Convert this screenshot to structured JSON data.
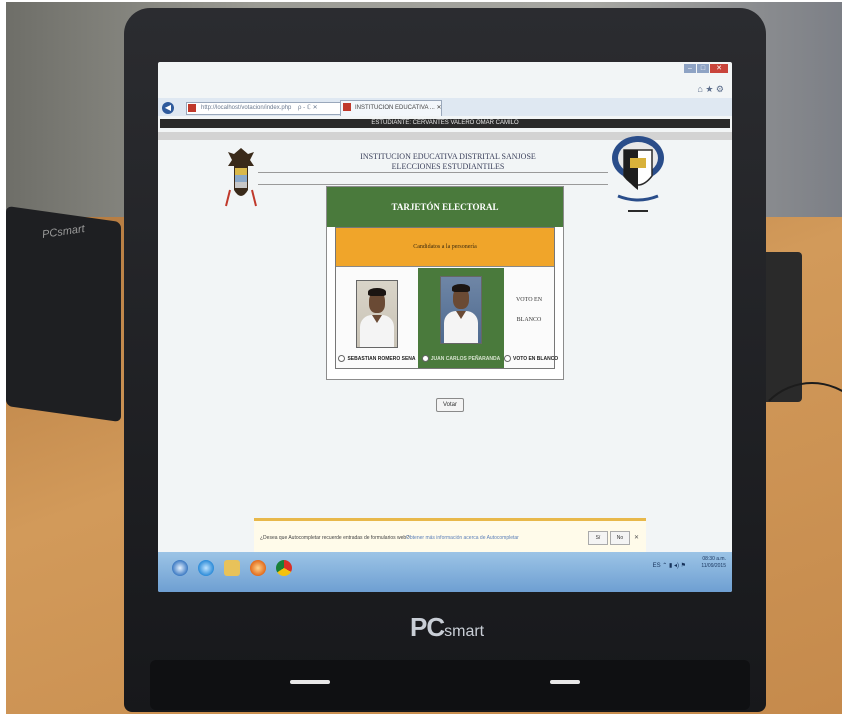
{
  "browser": {
    "address_text": "http://localhost/votacion/index.php",
    "address_controls": "ρ - ℂ ✕",
    "tab_title": "INSTITUCION EDUCATIVA ... ✕",
    "window_controls": {
      "minimize": "–",
      "maximize": "□",
      "close": "✕"
    },
    "toolbar_icons": "⌂ ★ ⚙"
  },
  "page": {
    "student_line": "ESTUDIANTE: CERVANTES VALERO OMAR CAMILO",
    "school_name": "INSTITUCION EDUCATIVA DISTRITAL SANJOSE",
    "election_title": "ELECCIONES ESTUDIANTILES"
  },
  "ballot": {
    "header": "TARJETÓN ELECTORAL",
    "position": "Candidatos a la personería",
    "candidates": [
      {
        "label": "SEBASTIAN ROMERO SENA"
      },
      {
        "label": "JUAN CARLOS PEÑARANDA"
      },
      {
        "label": "VOTO EN BLANCO"
      }
    ],
    "blank_text_line1": "VOTO EN",
    "blank_text_line2": "BLANCO",
    "vote_button": "Votar"
  },
  "autocomplete": {
    "message": "¿Desea que Autocompletar recuerde entradas de formularios web?",
    "link": "Obtener más información acerca de Autocompletar",
    "yes": "Sí",
    "no": "No",
    "close": "✕"
  },
  "taskbar": {
    "time": "08:30 a.m.",
    "date": "11/09/2015",
    "tray_icons": "ES ⌃ ▮ ◂) ⚑"
  },
  "device": {
    "brand": "PC",
    "brand_suffix": "smart",
    "side_brand": "PCsmart"
  },
  "colors": {
    "ballot_green": "#4a7a3c",
    "position_orange": "#f0a52a",
    "taskbar_blue": "#6e9fd2"
  }
}
